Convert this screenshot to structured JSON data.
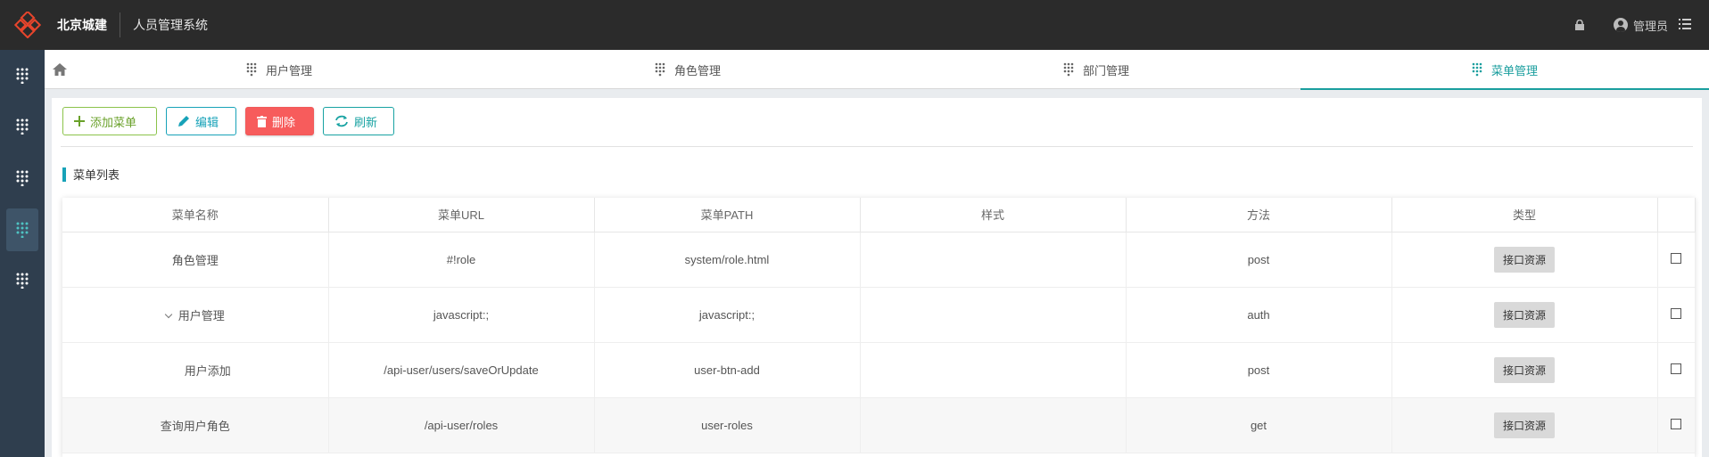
{
  "header": {
    "brand": "北京城建",
    "system_name": "人员管理系统",
    "user_name": "管理员",
    "lock_icon": "lock-icon",
    "menu_icon": "list-icon",
    "logo_color": "#e8452c"
  },
  "sidebar": {
    "items": [
      "grid-icon",
      "grid-icon",
      "grid-icon",
      "grid-icon",
      "grid-icon"
    ],
    "active_index": 3
  },
  "tabs": [
    {
      "label": "用户管理"
    },
    {
      "label": "角色管理"
    },
    {
      "label": "部门管理"
    },
    {
      "label": "菜单管理",
      "active": true
    }
  ],
  "toolbar": {
    "add": "添加菜单",
    "edit": "编辑",
    "delete": "删除",
    "refresh": "刷新"
  },
  "section": {
    "title": "菜单列表"
  },
  "table": {
    "columns": [
      "菜单名称",
      "菜单URL",
      "菜单PATH",
      "样式",
      "方法",
      "类型",
      ""
    ],
    "rows": [
      {
        "name": "角色管理",
        "url": "#!role",
        "path": "system/role.html",
        "style": "",
        "method": "post",
        "type": "接口资源"
      },
      {
        "name": "用户管理",
        "url": "javascript:;",
        "path": "javascript:;",
        "style": "",
        "method": "auth",
        "type": "接口资源",
        "expanded": true
      },
      {
        "name": "用户添加",
        "url": "/api-user/users/saveOrUpdate",
        "path": "user-btn-add",
        "style": "",
        "method": "post",
        "type": "接口资源"
      },
      {
        "name": "查询用户角色",
        "url": "/api-user/roles",
        "path": "user-roles",
        "style": "",
        "method": "get",
        "type": "接口资源"
      }
    ]
  },
  "colors": {
    "accent": "#1a9e9e",
    "danger": "#f75c5c",
    "success": "#8bc34a",
    "info": "#17a2b8"
  }
}
